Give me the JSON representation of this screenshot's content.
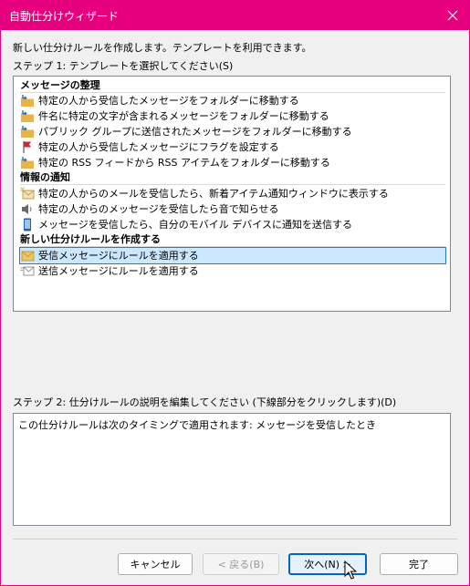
{
  "window": {
    "title": "自動仕分けウィザード"
  },
  "intro": "新しい仕分けルールを作成します。テンプレートを利用できます。",
  "step1_label": "ステップ 1: テンプレートを選択してください(S)",
  "groups": [
    {
      "heading": "メッセージの整理",
      "items": [
        {
          "label": "特定の人から受信したメッセージをフォルダーに移動する",
          "icon": "folder-move-icon"
        },
        {
          "label": "件名に特定の文字が含まれるメッセージをフォルダーに移動する",
          "icon": "folder-move-icon"
        },
        {
          "label": "パブリック グループに送信されたメッセージをフォルダーに移動する",
          "icon": "folder-move-icon"
        },
        {
          "label": "特定の人から受信したメッセージにフラグを設定する",
          "icon": "flag-icon"
        },
        {
          "label": "特定の RSS フィードから RSS アイテムをフォルダーに移動する",
          "icon": "folder-move-icon"
        }
      ]
    },
    {
      "heading": "情報の通知",
      "items": [
        {
          "label": "特定の人からのメールを受信したら、新着アイテム通知ウィンドウに表示する",
          "icon": "mail-alert-icon"
        },
        {
          "label": "特定の人からのメッセージを受信したら音で知らせる",
          "icon": "speaker-icon"
        },
        {
          "label": "メッセージを受信したら、自分のモバイル デバイスに通知を送信する",
          "icon": "mobile-device-icon"
        }
      ]
    },
    {
      "heading": "新しい仕分けルールを作成する",
      "items": [
        {
          "label": "受信メッセージにルールを適用する",
          "icon": "incoming-mail-icon",
          "selected": true
        },
        {
          "label": "送信メッセージにルールを適用する",
          "icon": "outgoing-mail-icon"
        }
      ]
    }
  ],
  "step2_label": "ステップ 2: 仕分けルールの説明を編集してください (下線部分をクリックします)(D)",
  "description": "この仕分けルールは次のタイミングで適用されます: メッセージを受信したとき",
  "buttons": {
    "cancel": "キャンセル",
    "back": "< 戻る(B)",
    "next": "次へ(N) >",
    "finish": "完了"
  },
  "colors": {
    "titlebar": "#e6007e",
    "selection": "#cce8ff",
    "primary_border": "#0067c0"
  }
}
